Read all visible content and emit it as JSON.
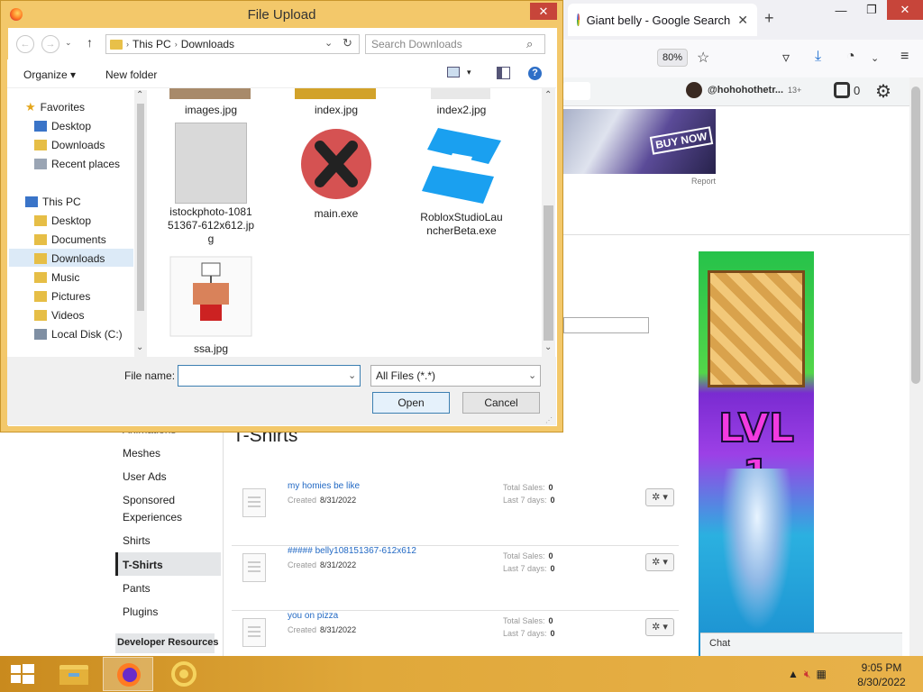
{
  "browser": {
    "tab_title": "Giant belly - Google Search",
    "tab_close": "✕",
    "new_tab": "+",
    "zoom": "80%",
    "account_name": "@hohohothetr...",
    "age_badge": "13+",
    "robux_count": "0",
    "ad_buy_now": "BUY NOW",
    "ad_report": "Report",
    "ad_lvl": "LVL 1",
    "chat_label": "Chat"
  },
  "page": {
    "section_title": "T-Shirts",
    "nav_items": [
      "Animations",
      "Meshes",
      "User Ads",
      "Sponsored",
      "Experiences",
      "Shirts",
      "T-Shirts",
      "Pants",
      "Plugins"
    ],
    "nav_dev": "Developer Resources",
    "rows": [
      {
        "name": "my homies be like",
        "created_label": "Created",
        "created": "8/31/2022",
        "total_label": "Total Sales:",
        "total": "0",
        "last7_label": "Last 7 days:",
        "last7": "0"
      },
      {
        "name": "##### belly108151367-612x612",
        "created_label": "Created",
        "created": "8/31/2022",
        "total_label": "Total Sales:",
        "total": "0",
        "last7_label": "Last 7 days:",
        "last7": "0"
      },
      {
        "name": "you on pizza",
        "created_label": "Created",
        "created": "8/31/2022",
        "total_label": "Total Sales:",
        "total": "0",
        "last7_label": "Last 7 days:",
        "last7": "0"
      }
    ],
    "gear_label": "✲ ▾"
  },
  "dialog": {
    "title": "File Upload",
    "close": "✕",
    "breadcrumb": [
      "This PC",
      "Downloads"
    ],
    "search_placeholder": "Search Downloads",
    "organize": "Organize",
    "new_folder": "New folder",
    "nav": {
      "favorites": "Favorites",
      "fav_items": [
        "Desktop",
        "Downloads",
        "Recent places"
      ],
      "this_pc": "This PC",
      "pc_items": [
        "Desktop",
        "Documents",
        "Downloads",
        "Music",
        "Pictures",
        "Videos",
        "Local Disk (C:)"
      ]
    },
    "files_top": [
      "images.jpg",
      "index.jpg",
      "index2.jpg"
    ],
    "files": [
      {
        "name": "istockphoto-1081\n51367-612x612.jp\ng"
      },
      {
        "name": "main.exe"
      },
      {
        "name": "RobloxStudioLau\nncherBeta.exe"
      },
      {
        "name": "ssa.jpg"
      }
    ],
    "file_name_label": "File name:",
    "file_name_value": "",
    "filter": "All Files (*.*)",
    "open": "Open",
    "cancel": "Cancel"
  },
  "taskbar": {
    "time": "9:05 PM",
    "date": "8/30/2022"
  },
  "colors": {
    "dialog_frame": "#f3c86a",
    "taskbar": "#e0a83a",
    "close_red": "#c7453a",
    "link_blue": "#2269c4"
  }
}
